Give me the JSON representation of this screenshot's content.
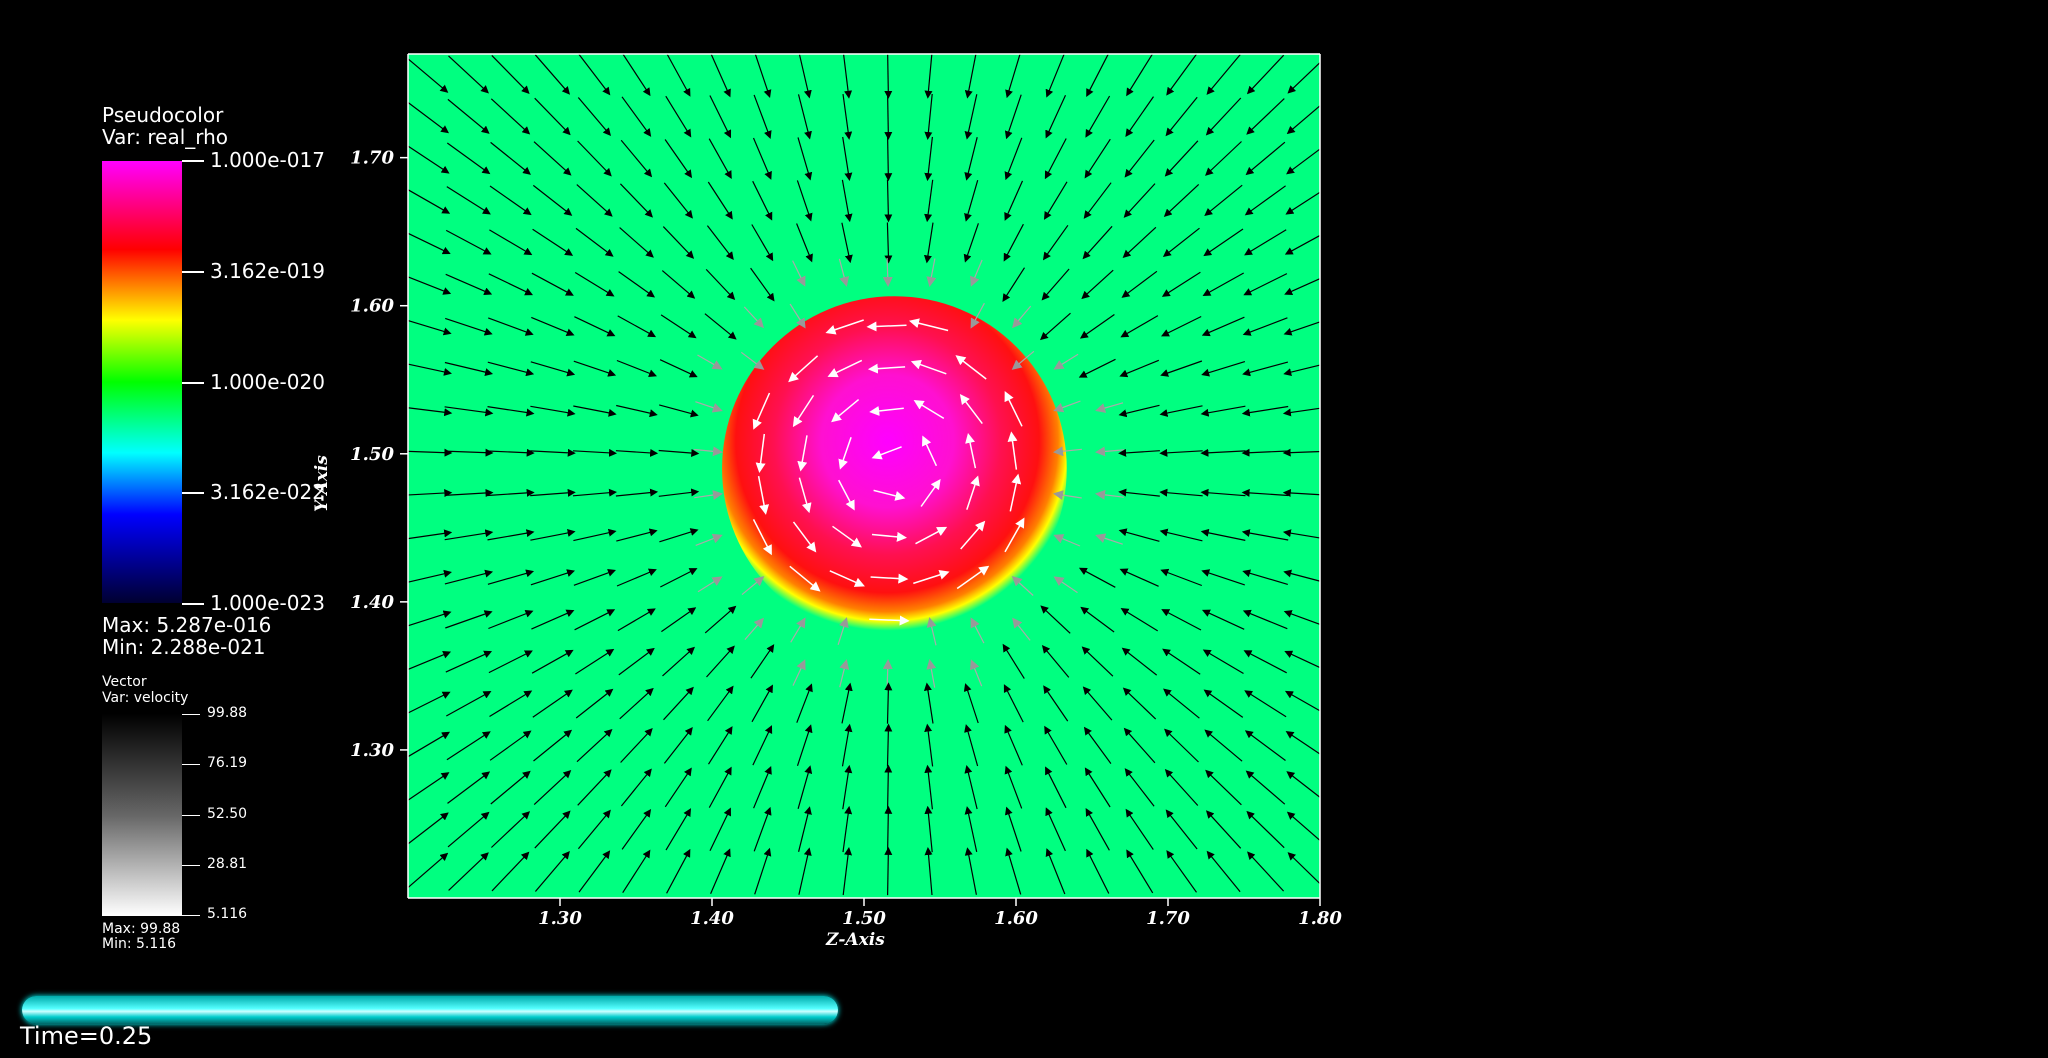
{
  "pseudocolor": {
    "title": "Pseudocolor",
    "var": "Var: real_rho",
    "ticks": [
      "1.000e-017",
      "3.162e-019",
      "1.000e-020",
      "3.162e-022",
      "1.000e-023"
    ],
    "max": "Max:  5.287e-016",
    "min": "Min:  2.288e-021"
  },
  "vector": {
    "title": "Vector",
    "var": "Var: velocity",
    "ticks": [
      "99.88",
      "76.19",
      "52.50",
      "28.81",
      "5.116"
    ],
    "max": "Max: 99.88",
    "min": "Min:  5.116"
  },
  "time": {
    "label": "Time=0.25",
    "progress": 0.25
  },
  "colors": {
    "background": "#00ff80",
    "blob_core": "#ff00ff",
    "blob_ring": "#ff1c1c",
    "arrow_outer": "#000000",
    "arrow_inner": "#ffffff"
  },
  "chart_data": {
    "type": "heatmap",
    "subtype": "pseudocolor + vector field",
    "xlabel": "Z-Axis",
    "ylabel": "Y-Axis",
    "xlim": [
      1.2,
      1.8
    ],
    "ylim": [
      1.2,
      1.77
    ],
    "xticks": [
      "1.30",
      "1.40",
      "1.50",
      "1.60",
      "1.70",
      "1.80"
    ],
    "xtick_values": [
      1.3,
      1.4,
      1.5,
      1.6,
      1.7,
      1.8
    ],
    "yticks": [
      "1.70",
      "1.60",
      "1.50",
      "1.40",
      "1.30"
    ],
    "ytick_values": [
      1.7,
      1.6,
      1.5,
      1.4,
      1.3
    ],
    "blob": {
      "center": [
        1.52,
        1.49
      ],
      "radius": 0.105,
      "core_center": [
        1.52,
        1.51
      ],
      "core_radius": 0.045
    },
    "vector_field": "inflow toward blob outside, swirl inside"
  }
}
